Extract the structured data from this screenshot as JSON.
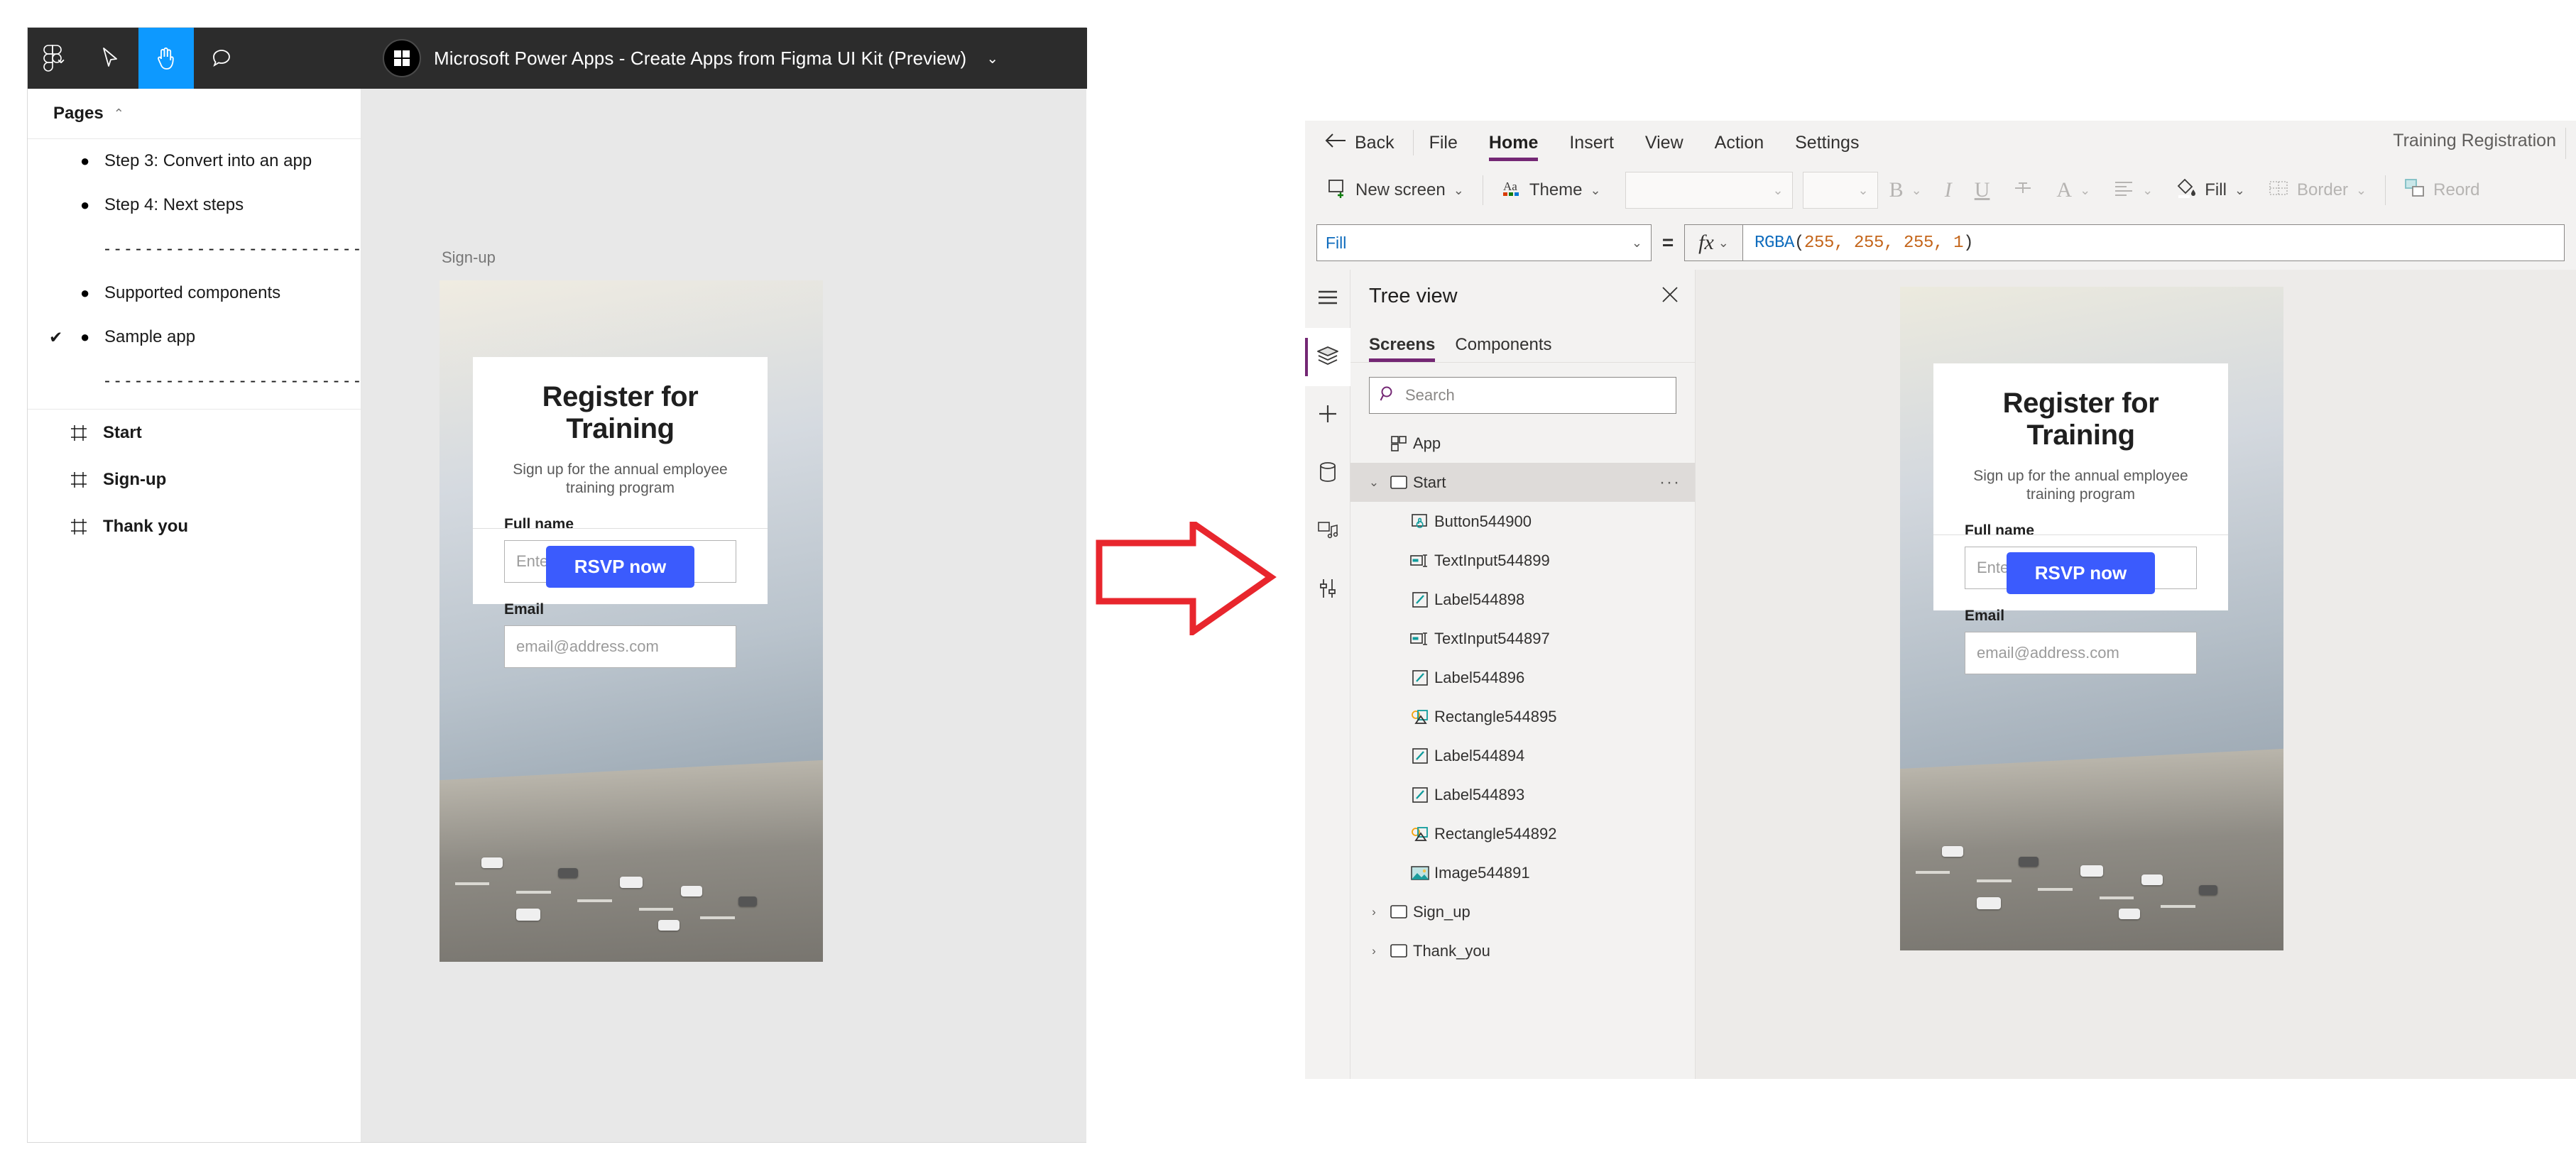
{
  "figma": {
    "toolbar": {
      "logo_caret": "⌄",
      "tools": [
        "figma-logo",
        "move-tool",
        "hand-tool",
        "comment-tool"
      ],
      "active_tool": "hand-tool",
      "file_title": "Microsoft Power Apps - Create Apps from Figma UI Kit (Preview)",
      "file_caret": "⌄"
    },
    "pages_panel": {
      "header": "Pages",
      "header_chevron": "⌃",
      "items": [
        {
          "label": "Step 3: Convert into an app",
          "bullet": "●",
          "checked": false,
          "separator": false
        },
        {
          "label": "Step 4: Next steps",
          "bullet": "●",
          "checked": false,
          "separator": false
        },
        {
          "label": "- - - - - - - - - - - - - - - - - - - - - - - - -",
          "separator": true
        },
        {
          "label": "Supported components",
          "bullet": "●",
          "checked": false,
          "separator": false
        },
        {
          "label": "Sample app",
          "bullet": "●",
          "checked": true,
          "check": "✔",
          "separator": false
        },
        {
          "label": "- - - - - - - - - - - - - - - - - - - - - - - - -",
          "separator": true
        }
      ]
    },
    "layers_panel": {
      "items": [
        {
          "label": "Start",
          "icon": "frame-icon"
        },
        {
          "label": "Sign-up",
          "icon": "frame-icon"
        },
        {
          "label": "Thank you",
          "icon": "frame-icon"
        }
      ]
    },
    "canvas": {
      "frame_label": "Sign-up",
      "card": {
        "heading": "Register for Training",
        "subheading": "Sign up for the annual employee training program",
        "fields": [
          {
            "label": "Full name",
            "placeholder": "Enter your name",
            "value": ""
          },
          {
            "label": "Email",
            "placeholder": "email@address.com",
            "value": ""
          }
        ],
        "button_label": "RSVP now",
        "button_color": "#3b5bfd"
      }
    }
  },
  "arrow": {
    "color": "#e8262d",
    "direction": "right"
  },
  "powerapps": {
    "menubar": {
      "back_label": "Back",
      "back_icon": "arrow-left-icon",
      "items": [
        "File",
        "Home",
        "Insert",
        "View",
        "Action",
        "Settings"
      ],
      "active": "Home",
      "accent": "#742774",
      "app_title": "Training Registration"
    },
    "ribbon": {
      "new_screen_label": "New screen",
      "new_screen_caret": "⌄",
      "theme_label": "Theme",
      "theme_caret": "⌄",
      "font_select_value": "",
      "font_size_value": "",
      "bold_label": "B",
      "italic_label": "I",
      "underline_label": "U",
      "strikethrough_label": "S",
      "font_color_label": "A",
      "align_label": "align",
      "fill_label": "Fill",
      "border_label": "Border",
      "reorder_label": "Reord"
    },
    "formula_bar": {
      "property_value": "Fill",
      "property_caret": "⌄",
      "equals": "=",
      "fx_label": "fx",
      "fx_caret": "⌄",
      "formula_fn": "RGBA",
      "formula_open": "(",
      "formula_args": "255, 255, 255, 1",
      "formula_close": ")",
      "formula_full": "RGBA(255, 255, 255, 1)"
    },
    "rail": {
      "items": [
        "hamburger-icon",
        "layers-icon",
        "plus-icon",
        "data-icon",
        "media-icon",
        "tools-icon"
      ],
      "active": "layers-icon"
    },
    "tree_view": {
      "title": "Tree view",
      "close_icon": "close-icon",
      "tabs": [
        "Screens",
        "Components"
      ],
      "active_tab": "Screens",
      "search_placeholder": "Search",
      "search_icon": "search-icon",
      "nodes": [
        {
          "label": "App",
          "icon": "app-icon",
          "level": "app",
          "chevron": "",
          "selected": false
        },
        {
          "label": "Start",
          "icon": "screen-icon",
          "level": "root",
          "chevron": "⌄",
          "selected": true,
          "more": "···"
        },
        {
          "label": "Button544900",
          "icon": "button-icon",
          "level": "child",
          "chevron": "",
          "selected": false
        },
        {
          "label": "TextInput544899",
          "icon": "textinput-icon",
          "level": "child",
          "chevron": "",
          "selected": false
        },
        {
          "label": "Label544898",
          "icon": "label-icon",
          "level": "child",
          "chevron": "",
          "selected": false
        },
        {
          "label": "TextInput544897",
          "icon": "textinput-icon",
          "level": "child",
          "chevron": "",
          "selected": false
        },
        {
          "label": "Label544896",
          "icon": "label-icon",
          "level": "child",
          "chevron": "",
          "selected": false
        },
        {
          "label": "Rectangle544895",
          "icon": "rectangle-icon",
          "level": "child",
          "chevron": "",
          "selected": false
        },
        {
          "label": "Label544894",
          "icon": "label-icon",
          "level": "child",
          "chevron": "",
          "selected": false
        },
        {
          "label": "Label544893",
          "icon": "label-icon",
          "level": "child",
          "chevron": "",
          "selected": false
        },
        {
          "label": "Rectangle544892",
          "icon": "rectangle-icon",
          "level": "child",
          "chevron": "",
          "selected": false
        },
        {
          "label": "Image544891",
          "icon": "image-icon",
          "level": "child",
          "chevron": "",
          "selected": false
        },
        {
          "label": "Sign_up",
          "icon": "screen-icon",
          "level": "root",
          "chevron": "›",
          "selected": false
        },
        {
          "label": "Thank_you",
          "icon": "screen-icon",
          "level": "root",
          "chevron": "›",
          "selected": false
        }
      ]
    },
    "canvas": {
      "card": {
        "heading": "Register for Training",
        "subheading": "Sign up for the annual employee training program",
        "fields": [
          {
            "label": "Full name",
            "placeholder": "Enter your name",
            "value": ""
          },
          {
            "label": "Email",
            "placeholder": "email@address.com",
            "value": ""
          }
        ],
        "button_label": "RSVP now",
        "button_color": "#3b5bfd"
      }
    }
  }
}
